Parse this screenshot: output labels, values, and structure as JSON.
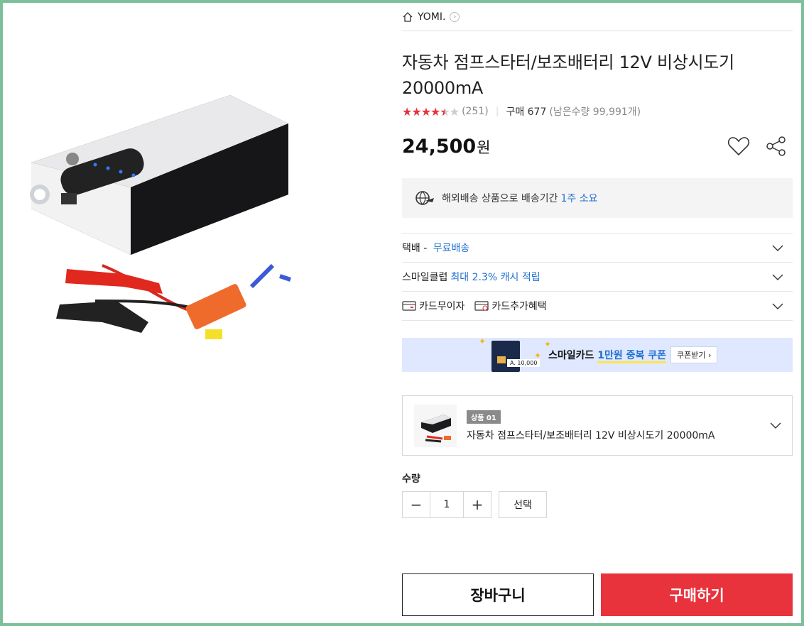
{
  "store": {
    "name": "YOMI.",
    "home_icon": "home-icon",
    "chevron": "›"
  },
  "product": {
    "title": "자동차 점프스타터/보조배터리 12V 비상시도기 20000mA",
    "rating": 4.5,
    "review_count": "(251)",
    "purchase_label": "구매 677",
    "remaining": "(남은수량 99,991개)",
    "price": "24,500",
    "currency": "원"
  },
  "shipping_notice": {
    "text": "해외배송 상품으로 배송기간 ",
    "highlight": "1주 소요"
  },
  "rows": {
    "delivery": {
      "label": "택배 - ",
      "value": "무료배송"
    },
    "smile_club": {
      "label": "스마일클럽 ",
      "value": "최대 2.3% 캐시 적립"
    },
    "card_interest_free": "카드무이자",
    "card_benefit": "카드추가혜택"
  },
  "banner": {
    "card_tag": "A. 10,000",
    "text_prefix": "스마일카드 ",
    "text_highlight": "1만원 중복 쿠폰",
    "button": "쿠폰받기 ›"
  },
  "option": {
    "badge": "상품 01",
    "name": "자동차 점프스타터/보조배터리 12V 비상시도기 20000mA"
  },
  "quantity": {
    "label": "수량",
    "value": "1",
    "minus": "−",
    "plus": "+",
    "select": "선택"
  },
  "buttons": {
    "cart": "장바구니",
    "buy": "구매하기"
  },
  "colors": {
    "accent_red": "#e8323c",
    "link_blue": "#1f6fd1",
    "frame_green": "#7dbf99"
  }
}
